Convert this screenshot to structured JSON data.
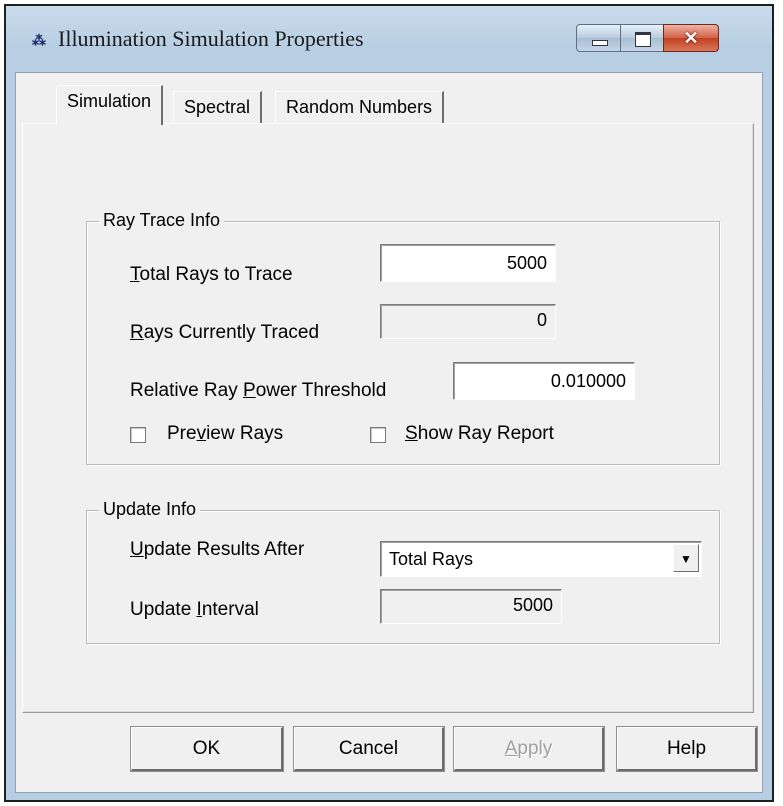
{
  "window": {
    "title": "Illumination Simulation Properties",
    "icon_text": "⁂"
  },
  "tabs": [
    {
      "label": "Simulation",
      "active": true
    },
    {
      "label": "Spectral",
      "active": false
    },
    {
      "label": "Random Numbers",
      "active": false
    }
  ],
  "ray_trace_info": {
    "group_label": "Ray Trace Info",
    "total_rays_label_u": "T",
    "total_rays_label_rest": "otal Rays to Trace",
    "total_rays_value": "5000",
    "rays_traced_label_u": "R",
    "rays_traced_label_rest": "ays Currently Traced",
    "rays_traced_value": "0",
    "threshold_label_pre": "Relative Ray ",
    "threshold_label_u": "P",
    "threshold_label_post": "ower Threshold",
    "threshold_value": "0.010000",
    "preview_pre": "Pre",
    "preview_u": "v",
    "preview_post": "iew Rays",
    "preview_checked": false,
    "report_u": "S",
    "report_post": "how Ray Report",
    "report_checked": false
  },
  "update_info": {
    "group_label": "Update Info",
    "after_label_u": "U",
    "after_label_rest": "pdate Results After",
    "after_value": "Total Rays",
    "interval_label_pre": "Update ",
    "interval_label_u": "I",
    "interval_label_post": "nterval",
    "interval_value": "5000"
  },
  "buttons": {
    "ok": "OK",
    "cancel": "Cancel",
    "apply_u": "A",
    "apply_rest": "pply",
    "help": "Help"
  }
}
